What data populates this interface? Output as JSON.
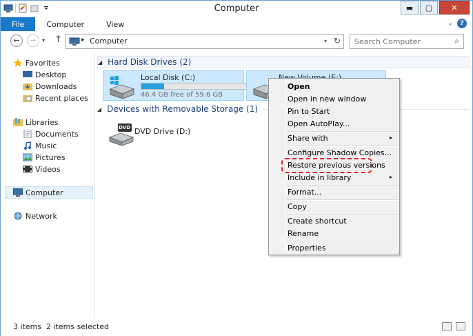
{
  "window": {
    "title": "Computer",
    "minimize_glyph": "▬",
    "maximize_glyph": "▢",
    "close_glyph": "✕"
  },
  "ribbon": {
    "tabs": [
      "File",
      "Computer",
      "View"
    ],
    "help_glyph": "?",
    "collapse_glyph": "⌄"
  },
  "nav": {
    "back_glyph": "←",
    "forward_glyph": "→",
    "recent_glyph": "▾",
    "up_glyph": "↑"
  },
  "address": {
    "crumb": "Computer",
    "crumb_arrow": "▸",
    "dropdown_glyph": "▾",
    "refresh_glyph": "↻"
  },
  "search": {
    "placeholder": "Search Computer",
    "icon_glyph": "⌕"
  },
  "navpane": {
    "favorites": {
      "label": "Favorites",
      "items": [
        "Desktop",
        "Downloads",
        "Recent places"
      ]
    },
    "libraries": {
      "label": "Libraries",
      "items": [
        "Documents",
        "Music",
        "Pictures",
        "Videos"
      ]
    },
    "computer": "Computer",
    "network": "Network"
  },
  "content": {
    "groups": [
      {
        "title": "Hard Disk Drives (2)",
        "chevron": "◢"
      },
      {
        "title": "Devices with Removable Storage (1)",
        "chevron": "◢"
      }
    ],
    "drives": [
      {
        "name": "Local Disk (C:)",
        "free_text": "46.4 GB free of 59.6 GB",
        "used_fraction": 0.22
      },
      {
        "name": "New Volume (E:)",
        "free_text": "",
        "used_fraction": 0
      }
    ],
    "dvd": {
      "name": "DVD Drive (D:)",
      "badge": "DVD"
    }
  },
  "context_menu": {
    "items": [
      {
        "label": "Open",
        "bold": true
      },
      {
        "label": "Open in new window"
      },
      {
        "label": "Pin to Start"
      },
      {
        "label": "Open AutoPlay..."
      },
      {
        "label": "Share with",
        "submenu": true
      },
      {
        "label": "Configure Shadow Copies..."
      },
      {
        "label": "Restore previous versions"
      },
      {
        "label": "Include in library",
        "submenu": true
      },
      {
        "label": "Format..."
      },
      {
        "label": "Copy"
      },
      {
        "label": "Create shortcut"
      },
      {
        "label": "Rename"
      },
      {
        "label": "Properties"
      }
    ],
    "submenu_glyph": "▸"
  },
  "status": {
    "item_count": "3 items",
    "selection": "2 items selected"
  },
  "colors": {
    "file_tab": "#1979ca",
    "selection_fill": "#cce8ff",
    "drive_bar_fill": "#26a0da",
    "highlight": "#e3202c"
  }
}
